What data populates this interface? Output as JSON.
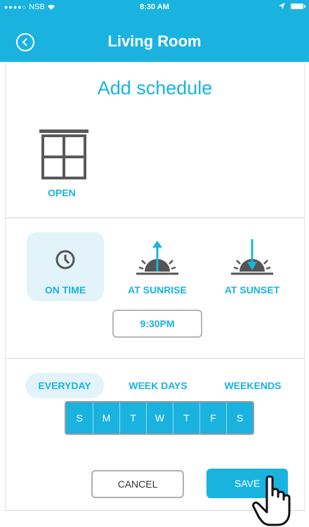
{
  "status_bar": {
    "carrier": "NSB",
    "time": "8:30 AM"
  },
  "nav": {
    "title": "Living Room"
  },
  "schedule": {
    "heading": "Add schedule",
    "action_label": "OPEN"
  },
  "trigger": {
    "modes": [
      {
        "label": "ON TIME"
      },
      {
        "label": "AT SUNRISE"
      },
      {
        "label": "AT SUNSET"
      }
    ],
    "time_value": "9:30PM"
  },
  "repeat": {
    "options": [
      {
        "label": "EVERYDAY"
      },
      {
        "label": "WEEK DAYS"
      },
      {
        "label": "WEEKENDS"
      }
    ],
    "days": [
      "S",
      "M",
      "T",
      "W",
      "T",
      "F",
      "S"
    ]
  },
  "actions": {
    "cancel_label": "CANCEL",
    "save_label": "SAVE"
  },
  "colors": {
    "accent": "#1ab3e0",
    "highlight": "#e3f3fa"
  },
  "icons": [
    "back-icon",
    "window-icon",
    "clock-icon",
    "sunrise-icon",
    "sunset-icon",
    "hand-pointer-icon",
    "wifi-icon",
    "location-icon",
    "battery-icon"
  ]
}
